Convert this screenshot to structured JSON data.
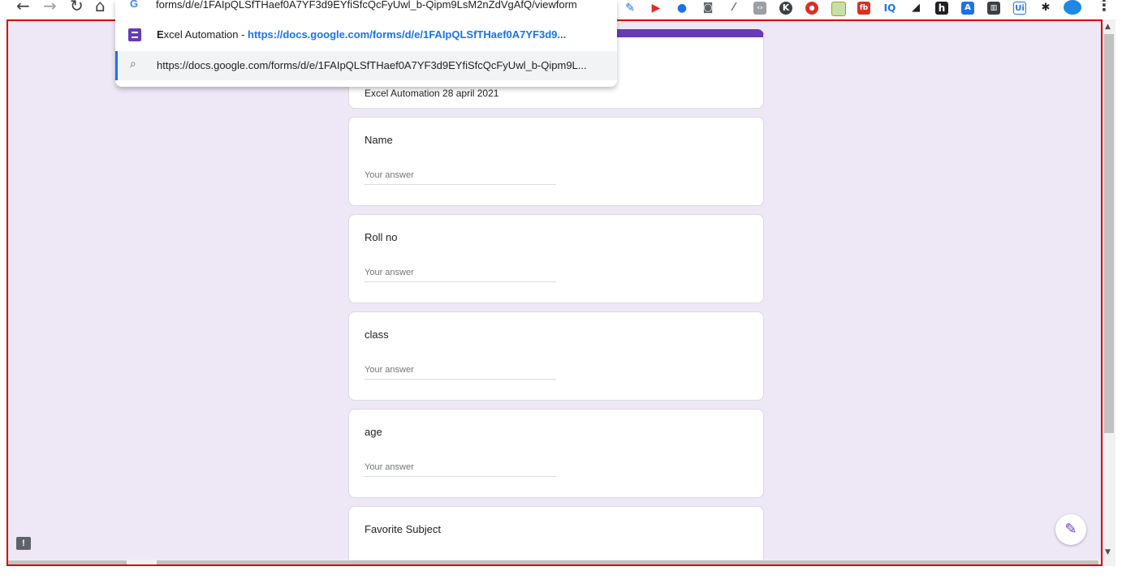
{
  "browser": {
    "omnibox_value": "forms/d/e/1FAIpQLSfTHaef0A7YF3d9EYfiSfcQcFyUwl_b-Qipm9LsM2nZdVgAfQ/viewform",
    "suggestions": [
      {
        "title_bold": "E",
        "title_rest": "xcel Automation",
        "separator": " - ",
        "url": "https://docs.google.com/forms/d/e/1FAIpQLSfTHaef0A7YF3d9..."
      },
      {
        "url": "https://docs.google.com/forms/d/e/1FAIpQLSfTHaef0A7YF3d9EYfiSfcQcFyUwl_b-Qipm9L..."
      }
    ],
    "extension_icons": [
      "pen-icon",
      "megaphone-icon",
      "drop-icon",
      "camera-icon",
      "eyedropper-icon",
      "code-icon",
      "k-icon",
      "record-icon",
      "notes-icon",
      "fb-icon",
      "iq-icon",
      "signal-icon",
      "h-icon",
      "translate-icon",
      "chart-icon",
      "ui-icon",
      "puzzle-icon",
      "profile-icon"
    ],
    "extension_labels": {
      "iq": "IQ",
      "ui": "Ui",
      "h": "h",
      "k": "K",
      "fb": "fb"
    }
  },
  "form": {
    "header_subtitle": "Excel Automation 28 april 2021",
    "questions": [
      {
        "label": "Name",
        "placeholder": "Your answer"
      },
      {
        "label": "Roll no",
        "placeholder": "Your answer"
      },
      {
        "label": "class",
        "placeholder": "Your answer"
      },
      {
        "label": "age",
        "placeholder": "Your answer"
      },
      {
        "label": "Favorite Subject",
        "placeholder": ""
      }
    ]
  },
  "colors": {
    "accent": "#673ab7",
    "background": "#ede7f6",
    "focus_border": "#d50000"
  }
}
